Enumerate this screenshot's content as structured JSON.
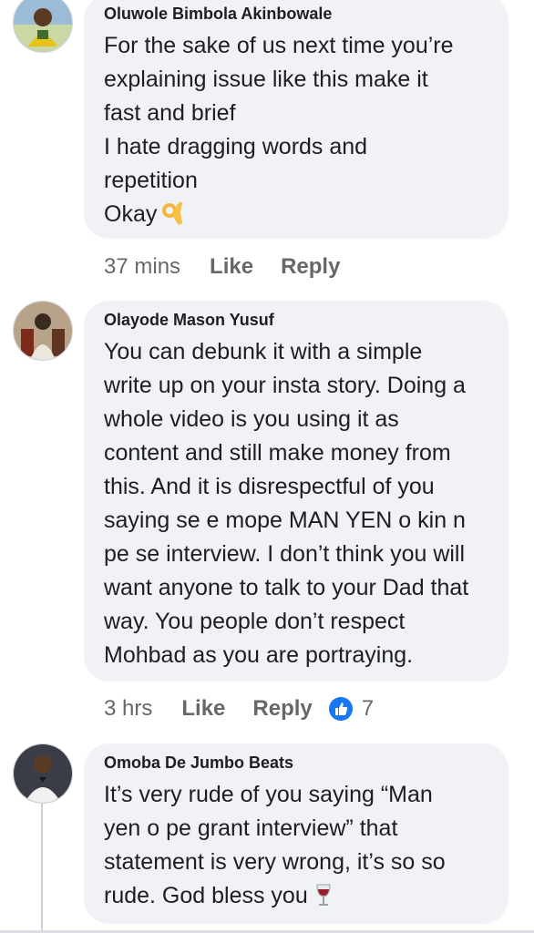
{
  "comments": [
    {
      "author": "Oluwole Bimbola Akinbowale",
      "text": "For the sake of us next time you’re\nexplaining issue like this make it\nfast and brief\nI hate dragging words and\nrepetition\nOkay",
      "emoji": "ok-hand-emoji",
      "time": "37 mins",
      "like_label": "Like",
      "reply_label": "Reply"
    },
    {
      "author": "Olayode Mason Yusuf",
      "text": "You can debunk it with a simple\nwrite up on your insta story. Doing a\nwhole video is you using it as\ncontent and still make money from\nthis. And it is disrespectful of you\nsaying se e mope MAN YEN o kin n\npe se interview. I don’t think you will\nwant anyone to talk to your Dad that\nway. You people don’t respect\nMohbad as you are portraying.",
      "time": "3 hrs",
      "like_label": "Like",
      "reply_label": "Reply",
      "reaction_icon": "like-thumb-icon",
      "reaction_count": "7"
    },
    {
      "author": "Omoba De Jumbo Beats",
      "text": "It’s very rude of you saying “Man\nyen o pe grant interview” that\nstatement is very wrong, it’s so so\nrude. God bless you",
      "emoji": "wine-glass-emoji"
    }
  ],
  "colors": {
    "bubble": "#f0f2f5",
    "meta_text": "#65676b",
    "like_blue": "#1877f2"
  }
}
